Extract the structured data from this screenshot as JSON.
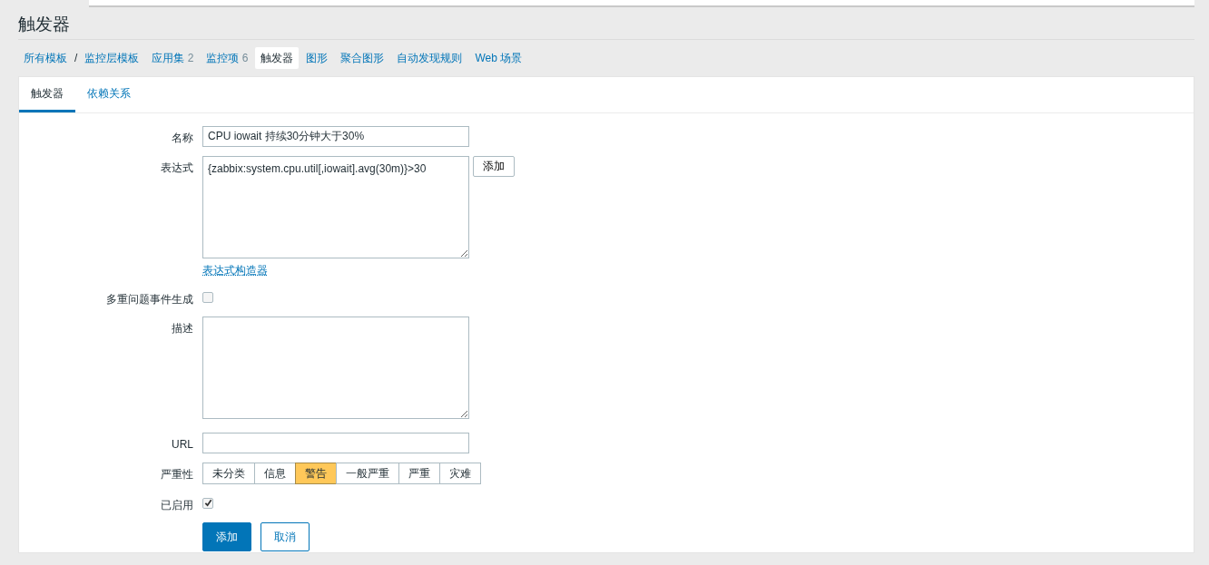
{
  "page_title": "触发器",
  "breadcrumbs": [
    {
      "label": "所有模板",
      "selected": false,
      "separator_after": "/"
    },
    {
      "label": "监控层模板",
      "selected": false
    },
    {
      "label": "应用集",
      "count": "2",
      "selected": false
    },
    {
      "label": "监控项",
      "count": "6",
      "selected": false
    },
    {
      "label": "触发器",
      "selected": true
    },
    {
      "label": "图形",
      "selected": false
    },
    {
      "label": "聚合图形",
      "selected": false
    },
    {
      "label": "自动发现规则",
      "selected": false
    },
    {
      "label": "Web 场景",
      "selected": false
    }
  ],
  "tabs": [
    {
      "label": "触发器",
      "selected": true
    },
    {
      "label": "依赖关系",
      "selected": false
    }
  ],
  "form": [
    {
      "kind": "text",
      "label": "名称",
      "value": "CPU iowait 持续30分钟大于30%"
    },
    {
      "kind": "expression",
      "label": "表达式",
      "value": "{zabbix:system.cpu.util[,iowait].avg(30m)}>30",
      "button": "添加",
      "link": "表达式构造器"
    },
    {
      "kind": "checkbox",
      "label": "多重问题事件生成",
      "checked": false
    },
    {
      "kind": "textarea",
      "label": "描述"
    },
    {
      "kind": "text",
      "label": "URL"
    },
    {
      "kind": "segmented",
      "label": "严重性",
      "options": [
        {
          "label": "未分类",
          "selected": false
        },
        {
          "label": "信息",
          "selected": false
        },
        {
          "label": "警告",
          "selected": true
        },
        {
          "label": "一般严重",
          "selected": false
        },
        {
          "label": "严重",
          "selected": false
        },
        {
          "label": "灾难",
          "selected": false
        }
      ]
    },
    {
      "kind": "checkbox",
      "label": "已启用",
      "checked": true
    }
  ],
  "actions": [
    {
      "label": "添加",
      "primary": true
    },
    {
      "label": "取消",
      "primary": false
    }
  ]
}
